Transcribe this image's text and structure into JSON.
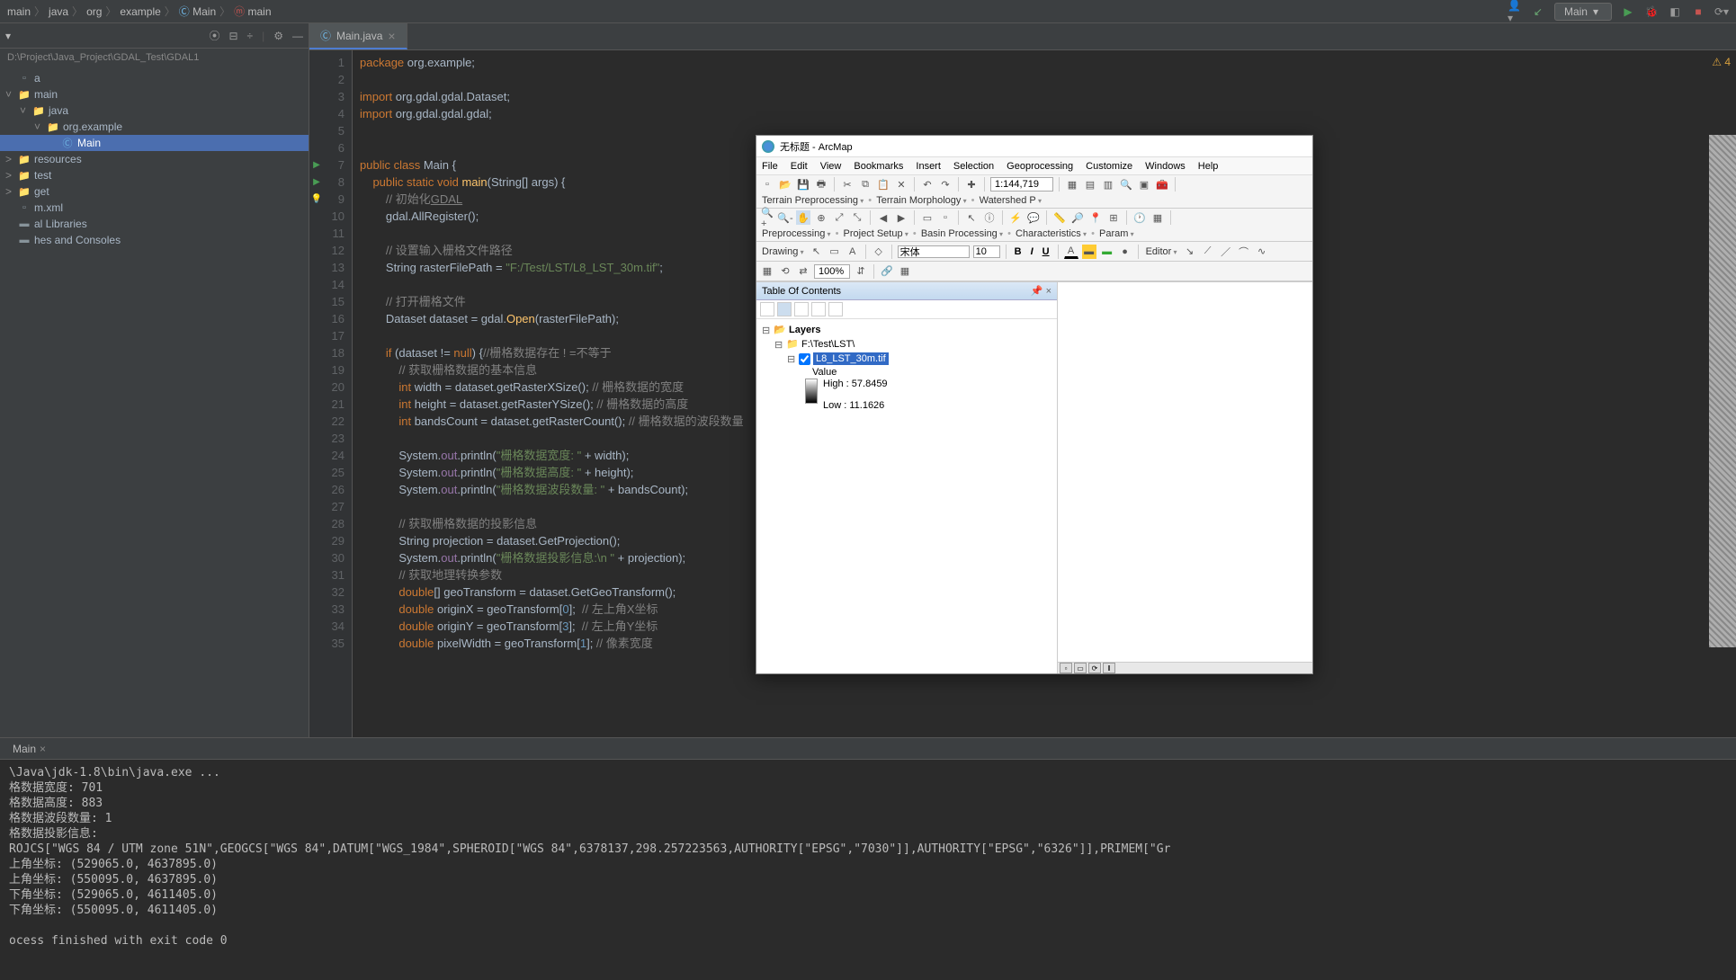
{
  "breadcrumb": {
    "parts": [
      "main",
      "java",
      "org",
      "example",
      "Main",
      "main"
    ],
    "run_config": "Main",
    "warnings": "4"
  },
  "project": {
    "path": "D:\\Project\\Java_Project\\GDAL_Test\\GDAL1",
    "items": [
      {
        "label": "a",
        "indent": 0,
        "type": "file"
      },
      {
        "label": "main",
        "indent": 0,
        "type": "folder",
        "open": true
      },
      {
        "label": "java",
        "indent": 1,
        "type": "folder",
        "open": true
      },
      {
        "label": "org.example",
        "indent": 2,
        "type": "folder",
        "open": true
      },
      {
        "label": "Main",
        "indent": 3,
        "type": "class",
        "selected": true
      },
      {
        "label": "resources",
        "indent": 0,
        "type": "folder"
      },
      {
        "label": "test",
        "indent": 0,
        "type": "folder"
      },
      {
        "label": "get",
        "indent": 0,
        "type": "folder"
      },
      {
        "label": "m.xml",
        "indent": 0,
        "type": "file"
      },
      {
        "label": "al Libraries",
        "indent": 0,
        "type": "lib"
      },
      {
        "label": "hes and Consoles",
        "indent": 0,
        "type": "lib"
      }
    ]
  },
  "editor": {
    "tab": "Main.java",
    "lines": [
      {
        "n": 1,
        "html": "<span class='kw'>package</span> org.example;"
      },
      {
        "n": 2,
        "html": ""
      },
      {
        "n": 3,
        "html": "<span class='kw'>import</span> org.gdal.gdal.Dataset;"
      },
      {
        "n": 4,
        "html": "<span class='kw'>import</span> org.gdal.gdal.gdal;"
      },
      {
        "n": 5,
        "html": ""
      },
      {
        "n": 6,
        "html": ""
      },
      {
        "n": 7,
        "html": "<span class='kw'>public class</span> Main {",
        "marker": "run"
      },
      {
        "n": 8,
        "html": "    <span class='kw'>public static void</span> <span class='method'>main</span>(String[] args) {",
        "marker": "run"
      },
      {
        "n": 9,
        "html": "        <span class='cmt'>// 初始化<u>GDAL</u></span>",
        "marker": "bulb"
      },
      {
        "n": 10,
        "html": "        gdal.AllRegister();"
      },
      {
        "n": 11,
        "html": ""
      },
      {
        "n": 12,
        "html": "        <span class='cmt'>// 设置输入栅格文件路径</span>"
      },
      {
        "n": 13,
        "html": "        String rasterFilePath = <span class='str'>\"F:/Test/LST/L8_LST_30m.tif\"</span>;"
      },
      {
        "n": 14,
        "html": ""
      },
      {
        "n": 15,
        "html": "        <span class='cmt'>// 打开栅格文件</span>"
      },
      {
        "n": 16,
        "html": "        Dataset dataset = gdal.<span class='method'>Open</span>(rasterFilePath);"
      },
      {
        "n": 17,
        "html": ""
      },
      {
        "n": 18,
        "html": "        <span class='kw'>if</span> (dataset != <span class='kw'>null</span>) {<span class='cmt'>//栅格数据存在 ! =不等于</span>"
      },
      {
        "n": 19,
        "html": "            <span class='cmt'>// 获取栅格数据的基本信息</span>"
      },
      {
        "n": 20,
        "html": "            <span class='kw'>int</span> width = dataset.getRasterXSize(); <span class='cmt'>// 栅格数据的宽度</span>"
      },
      {
        "n": 21,
        "html": "            <span class='kw'>int</span> height = dataset.getRasterYSize(); <span class='cmt'>// 栅格数据的高度</span>"
      },
      {
        "n": 22,
        "html": "            <span class='kw'>int</span> bandsCount = dataset.getRasterCount(); <span class='cmt'>// 栅格数据的波段数量</span>"
      },
      {
        "n": 23,
        "html": ""
      },
      {
        "n": 24,
        "html": "            System.<span class='field'>out</span>.println(<span class='str'>\"栅格数据宽度: \"</span> + width);"
      },
      {
        "n": 25,
        "html": "            System.<span class='field'>out</span>.println(<span class='str'>\"栅格数据高度: \"</span> + height);"
      },
      {
        "n": 26,
        "html": "            System.<span class='field'>out</span>.println(<span class='str'>\"栅格数据波段数量: \"</span> + bandsCount);"
      },
      {
        "n": 27,
        "html": ""
      },
      {
        "n": 28,
        "html": "            <span class='cmt'>// 获取栅格数据的投影信息</span>"
      },
      {
        "n": 29,
        "html": "            String projection = dataset.GetProjection();"
      },
      {
        "n": 30,
        "html": "            System.<span class='field'>out</span>.println(<span class='str'>\"栅格数据投影信息:\\n \"</span> + projection);"
      },
      {
        "n": 31,
        "html": "            <span class='cmt'>// 获取地理转换参数</span>"
      },
      {
        "n": 32,
        "html": "            <span class='kw'>double</span>[] geoTransform = dataset.GetGeoTransform();"
      },
      {
        "n": 33,
        "html": "            <span class='kw'>double</span> originX = geoTransform[<span class='num'>0</span>];  <span class='cmt'>// 左上角X坐标</span>"
      },
      {
        "n": 34,
        "html": "            <span class='kw'>double</span> originY = geoTransform[<span class='num'>3</span>];  <span class='cmt'>// 左上角Y坐标</span>"
      },
      {
        "n": 35,
        "html": "            <span class='kw'>double</span> pixelWidth = geoTransform[<span class='num'>1</span>]; <span class='cmt'>// 像素宽度</span>"
      }
    ]
  },
  "console": {
    "tab": "Main",
    "lines": [
      "\\Java\\jdk-1.8\\bin\\java.exe ...",
      "格数据宽度: 701",
      "格数据高度: 883",
      "格数据波段数量: 1",
      "格数据投影信息:",
      "ROJCS[\"WGS 84 / UTM zone 51N\",GEOGCS[\"WGS 84\",DATUM[\"WGS_1984\",SPHEROID[\"WGS 84\",6378137,298.257223563,AUTHORITY[\"EPSG\",\"7030\"]],AUTHORITY[\"EPSG\",\"6326\"]],PRIMEM[\"Gr",
      "上角坐标: (529065.0, 4637895.0)",
      "上角坐标: (550095.0, 4637895.0)",
      "下角坐标: (529065.0, 4611405.0)",
      "下角坐标: (550095.0, 4611405.0)",
      "",
      "ocess finished with exit code 0"
    ]
  },
  "arcmap": {
    "title": "无标题 - ArcMap",
    "menu": [
      "File",
      "Edit",
      "View",
      "Bookmarks",
      "Insert",
      "Selection",
      "Geoprocessing",
      "Customize",
      "Windows",
      "Help"
    ],
    "scale": "1:144,719",
    "toolbar_groups1": [
      "Terrain Preprocessing",
      "Terrain Morphology",
      "Watershed P"
    ],
    "toolbar_groups2": [
      "Preprocessing",
      "Project Setup",
      "Basin Processing",
      "Characteristics",
      "Param"
    ],
    "drawing_label": "Drawing",
    "font_name": "宋体",
    "font_size": "10",
    "editor_label": "Editor",
    "percent": "100%",
    "toc_title": "Table Of Contents",
    "layers_root": "Layers",
    "data_frame": "F:\\Test\\LST\\",
    "layer_name": "L8_LST_30m.tif",
    "value_label": "Value",
    "high_label": "High : 57.8459",
    "low_label": "Low : 11.1626"
  }
}
